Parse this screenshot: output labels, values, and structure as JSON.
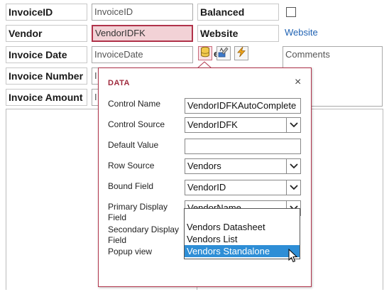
{
  "form": {
    "invoice_id": {
      "label": "InvoiceID",
      "value": "InvoiceID"
    },
    "vendor": {
      "label": "Vendor",
      "value": "VendorIDFK"
    },
    "invoice_date": {
      "label": "Invoice Date",
      "value": "InvoiceDate"
    },
    "invoice_number": {
      "label": "Invoice Number",
      "value": "I"
    },
    "invoice_amount": {
      "label": "Invoice Amount",
      "value": "I"
    },
    "balanced": {
      "label": "Balanced"
    },
    "website": {
      "label": "Website",
      "value": "Website"
    },
    "comments": {
      "value": "Comments"
    },
    "hidden_label_fragment": "e"
  },
  "colors": {
    "accent": "#b0334a",
    "selected_field_bg": "#f2d2d6",
    "link": "#1f62b3",
    "highlight": "#2e8ed6"
  },
  "toolbar": {
    "icons": [
      "database-icon",
      "formatting-icon",
      "lightning-icon"
    ]
  },
  "popup": {
    "title": "DATA",
    "close_symbol": "×",
    "control_name": {
      "label": "Control Name",
      "value": "VendorIDFKAutoComplete"
    },
    "control_source": {
      "label": "Control Source",
      "value": "VendorIDFK"
    },
    "default_value": {
      "label": "Default Value",
      "value": ""
    },
    "row_source": {
      "label": "Row Source",
      "value": "Vendors"
    },
    "bound_field": {
      "label": "Bound Field",
      "value": "VendorID"
    },
    "primary_display_field": {
      "label_line1": "Primary Display",
      "label_line2": "Field",
      "value": "VendorName"
    },
    "secondary_display_field": {
      "label_line1": "Secondary Display",
      "label_line2": "Field"
    },
    "popup_view": {
      "label": "Popup view"
    },
    "popup_view_options": [
      "",
      "Vendors Datasheet",
      "Vendors List",
      "Vendors Standalone"
    ],
    "popup_view_highlighted": "Vendors Standalone"
  }
}
